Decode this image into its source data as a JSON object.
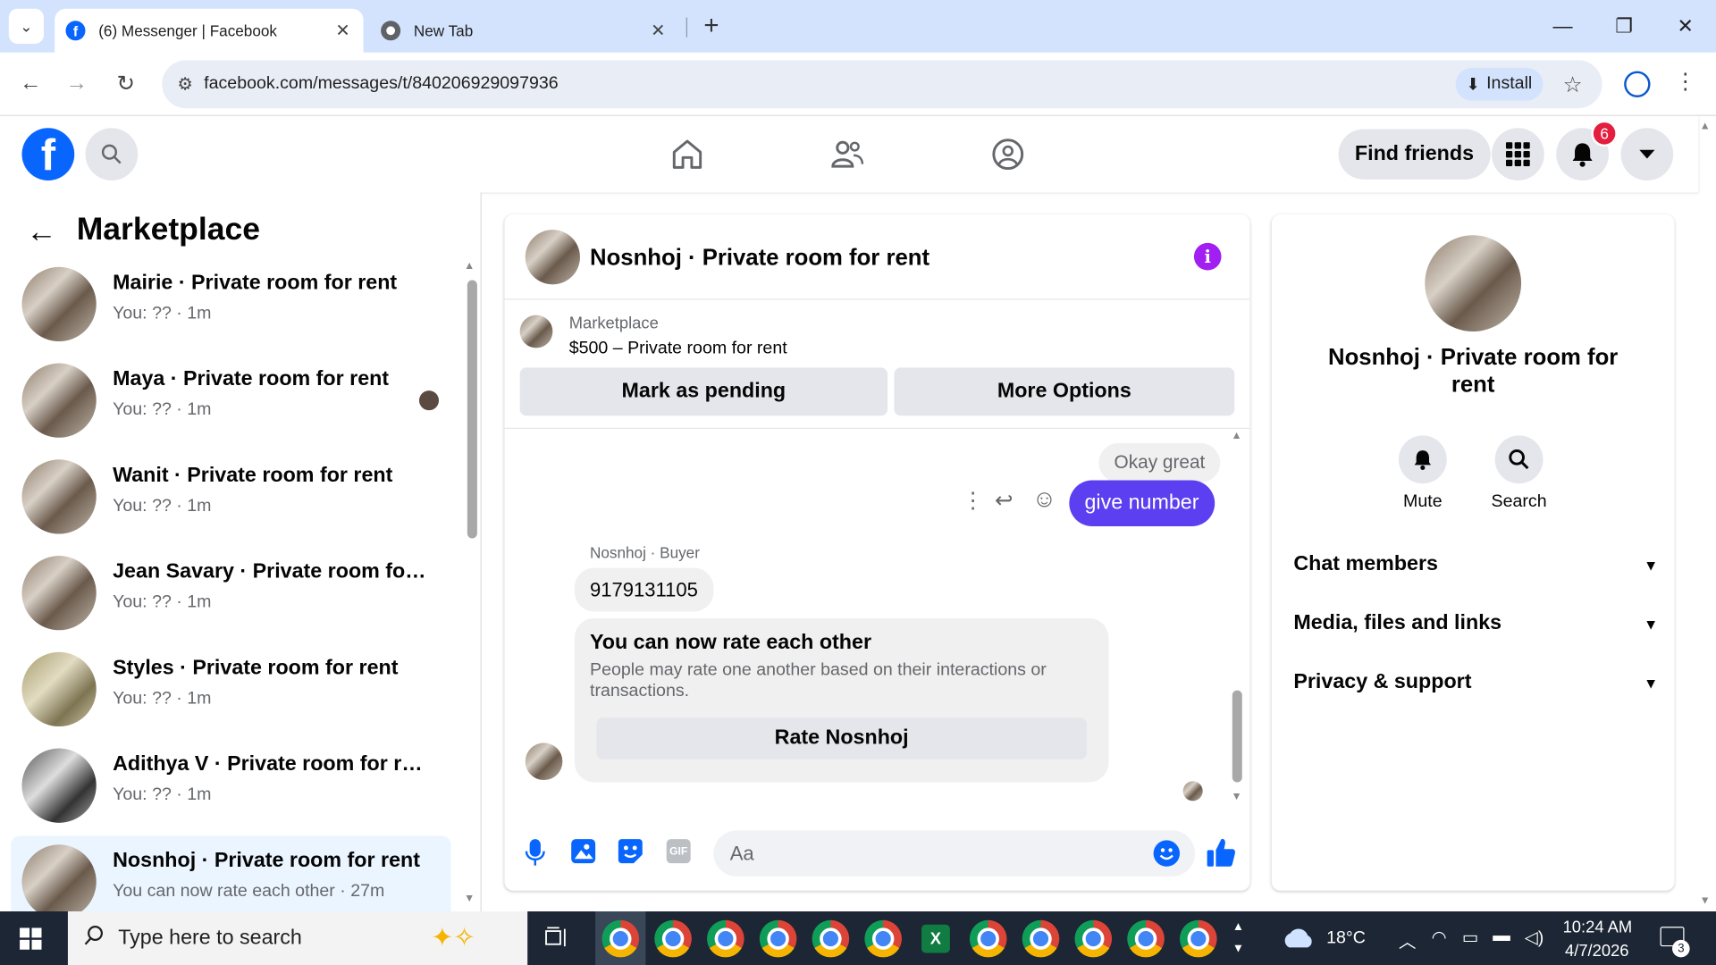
{
  "browser": {
    "tabs": [
      {
        "title": "(6) Messenger | Facebook",
        "active": true
      },
      {
        "title": "New Tab",
        "active": false
      }
    ],
    "url": "facebook.com/messages/t/840206929097936",
    "install_label": "Install"
  },
  "fb_header": {
    "find_friends": "Find friends",
    "notification_count": "6"
  },
  "left": {
    "title": "Marketplace",
    "conversations": [
      {
        "name": "Mairie · Private room for rent",
        "sub": "You: ?? · 1m"
      },
      {
        "name": "Maya · Private room for rent",
        "sub": "You: ?? · 1m"
      },
      {
        "name": "Wanit · Private room for rent",
        "sub": "You: ?? · 1m"
      },
      {
        "name": "Jean Savary · Private room for r...",
        "sub": "You: ?? · 1m"
      },
      {
        "name": "Styles · Private room for rent",
        "sub": "You: ?? · 1m"
      },
      {
        "name": "Adithya V · Private room for rent",
        "sub": "You: ?? · 1m"
      },
      {
        "name": "Nosnhoj · Private room for rent",
        "sub": "You can now rate each other · 27m"
      }
    ]
  },
  "chat": {
    "title": "Nosnhoj · Private room for rent",
    "listing_source": "Marketplace",
    "listing_title": "$500 – Private room for rent",
    "mark_pending": "Mark as pending",
    "more_options": "More Options",
    "msg_okay": "Okay great",
    "msg_give": "give number",
    "sender_label": "Nosnhoj · Buyer",
    "msg_number": "9179131105",
    "rate_title": "You can now rate each other",
    "rate_desc": "People may rate one another based on their interactions or transactions.",
    "rate_button": "Rate Nosnhoj",
    "composer_placeholder": "Aa",
    "gif_label": "GIF"
  },
  "info": {
    "name": "Nosnhoj · Private room for rent",
    "mute": "Mute",
    "search": "Search",
    "chat_members": "Chat members",
    "media": "Media, files and links",
    "privacy": "Privacy & support"
  },
  "taskbar": {
    "search_placeholder": "Type here to search",
    "weather": "18°C",
    "time": "10:24 AM",
    "date": "4/7/2026",
    "notif_count": "3"
  },
  "colors": {
    "fb_blue": "#0866ff",
    "messenger_purple": "#7b2ff7",
    "outgoing_bubble": "#5b3ff0",
    "badge_red": "#e41e3f"
  }
}
